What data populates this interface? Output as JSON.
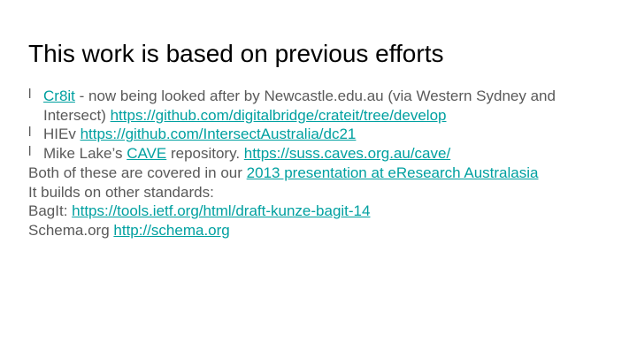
{
  "slide": {
    "title": "This work is based on previous efforts",
    "bullet_marker": "l",
    "items": [
      {
        "link1_text": "Cr8it",
        "text1": " - now being looked after by Newcastle.edu.au (via Western Sydney and",
        "text2": "Intersect) ",
        "link2_text": "https://github.com/digitalbridge/crateit/tree/develop"
      },
      {
        "text1": "HIEv ",
        "link1_text": "https://github.com/IntersectAustralia/dc21"
      },
      {
        "text1": "Mike Lake’s ",
        "link1_text": "CAVE",
        "text2": " repository. ",
        "link2_text": "https://suss.caves.org.au/cave/"
      }
    ],
    "paragraphs": [
      {
        "text": "Both of these are covered in our ",
        "link_text": "2013 presentation at eResearch Australasia"
      },
      {
        "text": "It builds on other standards:"
      },
      {
        "text": "BagIt: ",
        "link_text": "https://tools.ietf.org/html/draft-kunze-bagit-14"
      },
      {
        "text": "Schema.org ",
        "link_text": "http://schema.org"
      }
    ]
  },
  "colors": {
    "title": "#000000",
    "body_text": "#595959",
    "link": "#00a0a0",
    "background": "#ffffff"
  }
}
